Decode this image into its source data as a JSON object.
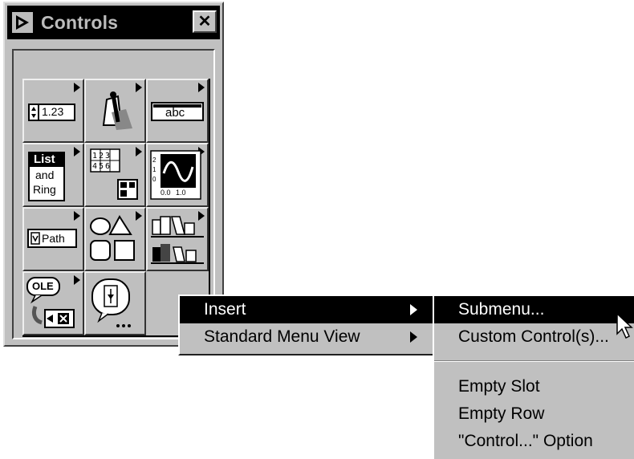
{
  "window": {
    "title": "Controls",
    "close_label": "✕"
  },
  "palette": {
    "cells": [
      {
        "name": "numeric",
        "label": "1.23"
      },
      {
        "name": "boolean",
        "label": ""
      },
      {
        "name": "string-path",
        "label": "abc"
      },
      {
        "name": "list-ring",
        "label_line1": "List",
        "label_line2": "and",
        "label_line3": "Ring"
      },
      {
        "name": "array-cluster",
        "label": "123 456"
      },
      {
        "name": "graph",
        "label": "0.0 1.0"
      },
      {
        "name": "path-refnum",
        "label": "Path"
      },
      {
        "name": "decorations",
        "label": ""
      },
      {
        "name": "user-controls",
        "label": ""
      },
      {
        "name": "activex",
        "label": "OLE"
      },
      {
        "name": "select-control",
        "label": ""
      }
    ]
  },
  "context_menu": {
    "items": [
      {
        "label": "Insert",
        "highlighted": true,
        "has_submenu": true
      },
      {
        "label": "Standard Menu View",
        "highlighted": false,
        "has_submenu": true
      }
    ]
  },
  "submenu": {
    "items": [
      {
        "label": "Submenu...",
        "highlighted": true
      },
      {
        "label": "Custom Control(s)...",
        "highlighted": false
      },
      {
        "label": "Empty Slot",
        "highlighted": false
      },
      {
        "label": "Empty Row",
        "highlighted": false
      },
      {
        "label": "\"Control...\" Option",
        "highlighted": false
      }
    ]
  }
}
